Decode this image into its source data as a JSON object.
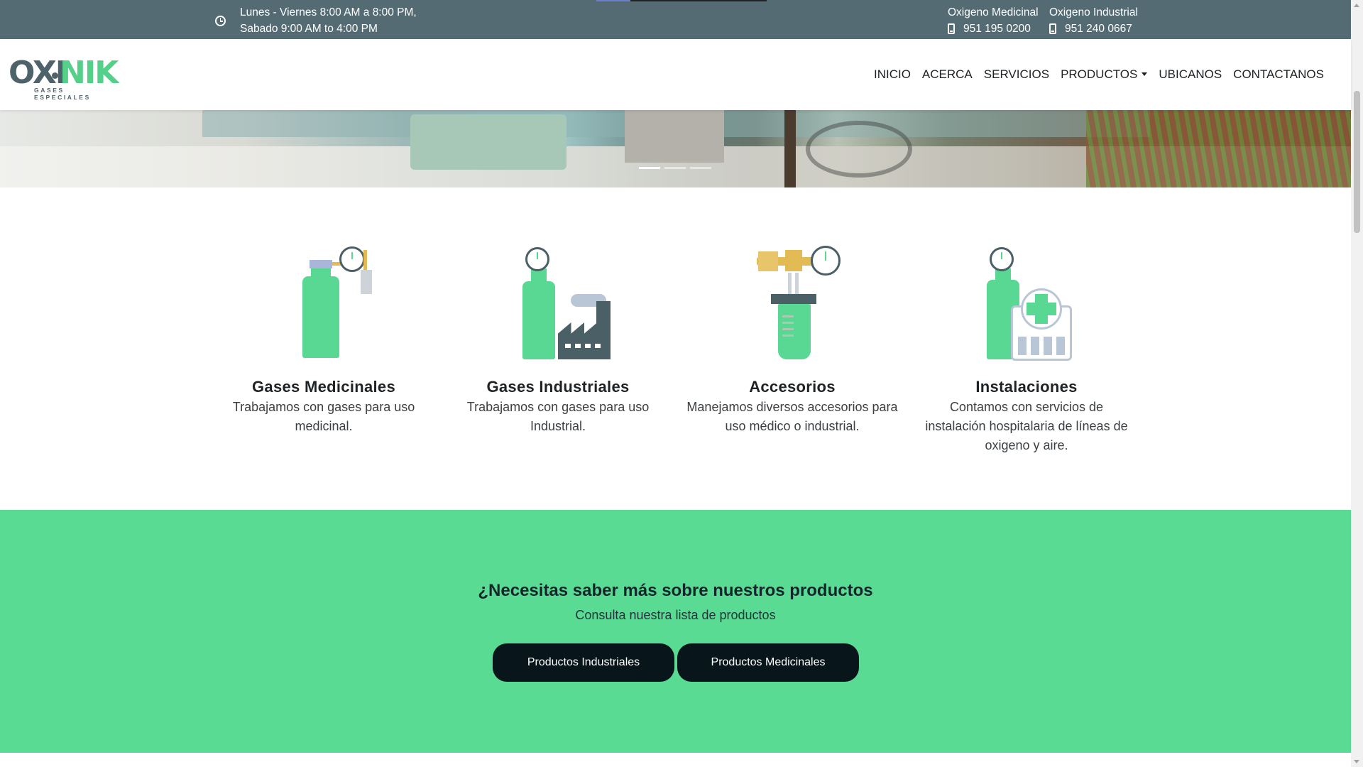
{
  "topbar": {
    "hours_line1": "Lunes - Viernes 8:00 AM a 8:00 PM,",
    "hours_line2": "Sabado 9:00 AM to 4:00 PM",
    "phones": [
      {
        "label": "Oxigeno Medicinal",
        "number": "951 195 0200"
      },
      {
        "label": "Oxigeno Industrial",
        "number": "951 240 0667"
      }
    ]
  },
  "logo": {
    "main_left": "OXI",
    "main_right": "NIK",
    "subtitle": "GASES ESPECIALES"
  },
  "nav": {
    "items": [
      "INICIO",
      "ACERCA",
      "SERVICIOS",
      "PRODUCTOS",
      "UBICANOS",
      "CONTACTANOS"
    ]
  },
  "carousel": {
    "slides": 3,
    "active_index": 0
  },
  "services": [
    {
      "title": "Gases Medicinales",
      "text": "Trabajamos con gases para uso medicinal.",
      "icon": "medical-gas-cylinder-icon"
    },
    {
      "title": "Gases Industriales",
      "text": "Trabajamos con gases para uso Industrial.",
      "icon": "industrial-factory-cylinder-icon"
    },
    {
      "title": "Accesorios",
      "text": "Manejamos diversos accesorios para uso médico o industrial.",
      "icon": "regulator-accessory-icon"
    },
    {
      "title": "Instalaciones",
      "text": "Contamos con servicios de instalación hospitalaria de líneas de oxigeno y aire.",
      "icon": "hospital-installation-icon"
    }
  ],
  "cta": {
    "title": "¿Necesitas saber más sobre nuestros productos",
    "subtitle": "Consulta nuestra lista de productos",
    "buttons": [
      "Productos Industriales",
      "Productos Medicinales"
    ]
  },
  "colors": {
    "topbar": "#546b73",
    "accent_green": "#5adb93",
    "button_dark": "#08161c",
    "logo_gray": "#4e6269"
  }
}
